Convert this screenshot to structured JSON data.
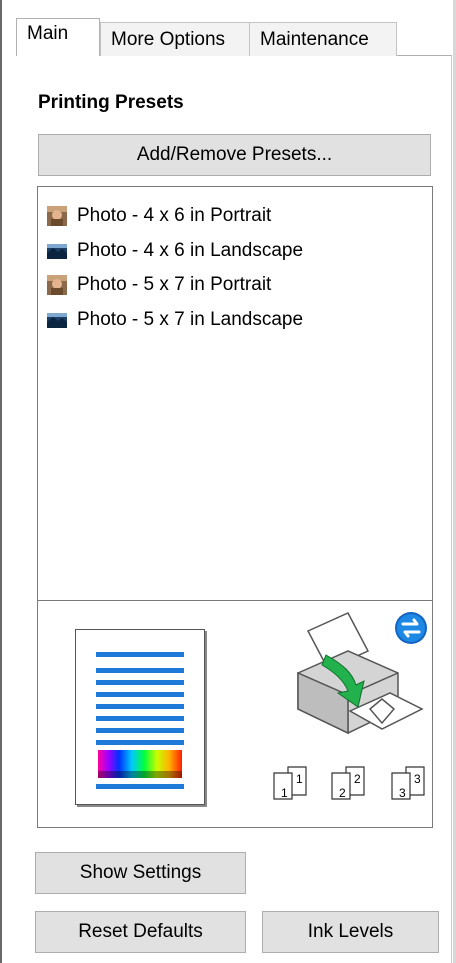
{
  "tabs": [
    {
      "label": "Main",
      "active": true
    },
    {
      "label": "More Options",
      "active": false
    },
    {
      "label": "Maintenance",
      "active": false
    }
  ],
  "printing_presets": {
    "title": "Printing Presets",
    "add_remove_label": "Add/Remove Presets...",
    "items": [
      {
        "label": "Photo - 4 x 6 in Portrait",
        "icon": "portrait-photo-icon"
      },
      {
        "label": "Photo - 4 x 6 in Landscape",
        "icon": "landscape-photo-icon"
      },
      {
        "label": "Photo - 5 x 7 in Portrait",
        "icon": "portrait-photo-icon"
      },
      {
        "label": "Photo - 5 x 7 in Landscape",
        "icon": "landscape-photo-icon"
      }
    ]
  },
  "preview": {
    "page_icon": "page-layout-preview-icon",
    "printer_icon": "printer-paper-feed-icon",
    "sync_icon": "blue-sync-icon",
    "collate_labels": [
      "1",
      "1",
      "2",
      "2",
      "3",
      "3"
    ]
  },
  "buttons": {
    "show_settings": "Show Settings",
    "reset_defaults": "Reset Defaults",
    "ink_levels": "Ink Levels"
  },
  "colors": {
    "accent_blue": "#1e7ad8",
    "button_face": "#e1e1e1",
    "sync_blue": "#1565c0",
    "arrow_green": "#22b14c"
  }
}
